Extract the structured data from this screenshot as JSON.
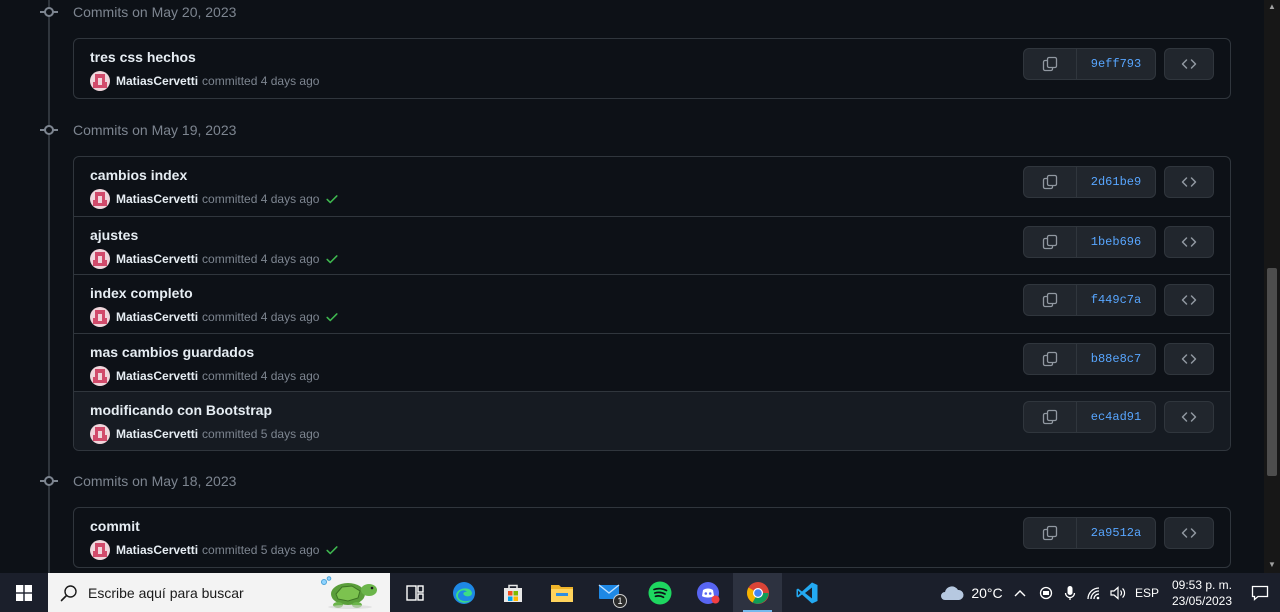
{
  "groups": [
    {
      "label": "Commits on May 20, 2023",
      "commits": [
        {
          "title": "tres css hechos",
          "author": "MatiasCervetti",
          "time": "committed 4 days ago",
          "sha": "9eff793",
          "verified": false
        }
      ]
    },
    {
      "label": "Commits on May 19, 2023",
      "commits": [
        {
          "title": "cambios index",
          "author": "MatiasCervetti",
          "time": "committed 4 days ago",
          "sha": "2d61be9",
          "verified": true
        },
        {
          "title": "ajustes",
          "author": "MatiasCervetti",
          "time": "committed 4 days ago",
          "sha": "1beb696",
          "verified": true
        },
        {
          "title": "index completo",
          "author": "MatiasCervetti",
          "time": "committed 4 days ago",
          "sha": "f449c7a",
          "verified": true
        },
        {
          "title": "mas cambios guardados",
          "author": "MatiasCervetti",
          "time": "committed 4 days ago",
          "sha": "b88e8c7",
          "verified": false
        },
        {
          "title": "modificando con Bootstrap",
          "author": "MatiasCervetti",
          "time": "committed 5 days ago",
          "sha": "ec4ad91",
          "verified": false
        }
      ]
    },
    {
      "label": "Commits on May 18, 2023",
      "commits": [
        {
          "title": "commit",
          "author": "MatiasCervetti",
          "time": "committed 5 days ago",
          "sha": "2a9512a",
          "verified": true
        }
      ]
    }
  ],
  "taskbar": {
    "search_placeholder": "Escribe aquí para buscar",
    "mail_badge": "1",
    "apps": [
      "task-view-icon",
      "edge-icon",
      "store-icon",
      "file-explorer-icon",
      "mail-icon",
      "spotify-icon",
      "discord-icon",
      "chrome-icon",
      "vscode-icon"
    ],
    "active_app": "chrome-icon",
    "temperature": "20°C",
    "language": "ESP",
    "time": "09:53 p. m.",
    "date": "23/05/2023"
  },
  "colors": {
    "background": "#0d1117",
    "border": "#30363d",
    "sha_link": "#58a6ff",
    "check": "#3fb950",
    "muted": "#7d8590"
  }
}
